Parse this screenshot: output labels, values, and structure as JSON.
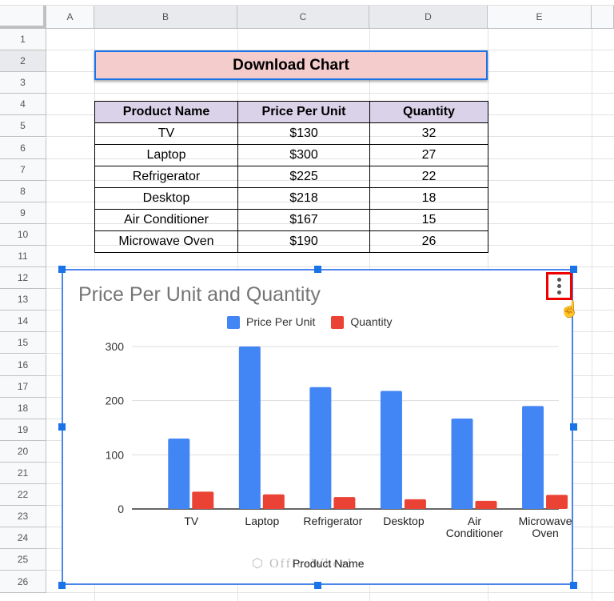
{
  "columns": [
    "A",
    "B",
    "C",
    "D",
    "E"
  ],
  "rows": [
    "1",
    "2",
    "3",
    "4",
    "5",
    "6",
    "7",
    "8",
    "9",
    "10",
    "11",
    "12",
    "13",
    "14",
    "15",
    "16",
    "17",
    "18",
    "19",
    "20",
    "21",
    "22",
    "23",
    "24",
    "25",
    "26"
  ],
  "button": {
    "label": "Download Chart"
  },
  "table": {
    "headers": [
      "Product Name",
      "Price Per Unit",
      "Quantity"
    ],
    "rows": [
      [
        "TV",
        "$130",
        "32"
      ],
      [
        "Laptop",
        "$300",
        "27"
      ],
      [
        "Refrigerator",
        "$225",
        "22"
      ],
      [
        "Desktop",
        "$218",
        "18"
      ],
      [
        "Air Conditioner",
        "$167",
        "15"
      ],
      [
        "Microwave Oven",
        "$190",
        "26"
      ]
    ]
  },
  "chart_menu_icon": "three-dots-vertical-icon",
  "watermark": "OfficeWheel",
  "chart_data": {
    "type": "bar",
    "title": "Price Per Unit and Quantity",
    "xlabel": "Product Name",
    "ylabel": "",
    "categories": [
      "TV",
      "Laptop",
      "Refrigerator",
      "Desktop",
      "Air Conditioner",
      "Microwave Oven"
    ],
    "category_lines": [
      [
        "TV"
      ],
      [
        "Laptop"
      ],
      [
        "Refrigerator"
      ],
      [
        "Desktop"
      ],
      [
        "Air",
        "Conditioner"
      ],
      [
        "Microwave",
        "Oven"
      ]
    ],
    "series": [
      {
        "name": "Price Per Unit",
        "values": [
          130,
          300,
          225,
          218,
          167,
          190
        ],
        "color": "#4285f4"
      },
      {
        "name": "Quantity",
        "values": [
          32,
          27,
          22,
          18,
          15,
          26
        ],
        "color": "#ea4335"
      }
    ],
    "ylim": [
      0,
      300
    ],
    "yticks": [
      0,
      100,
      200,
      300
    ],
    "grid": true,
    "legend": "top"
  }
}
